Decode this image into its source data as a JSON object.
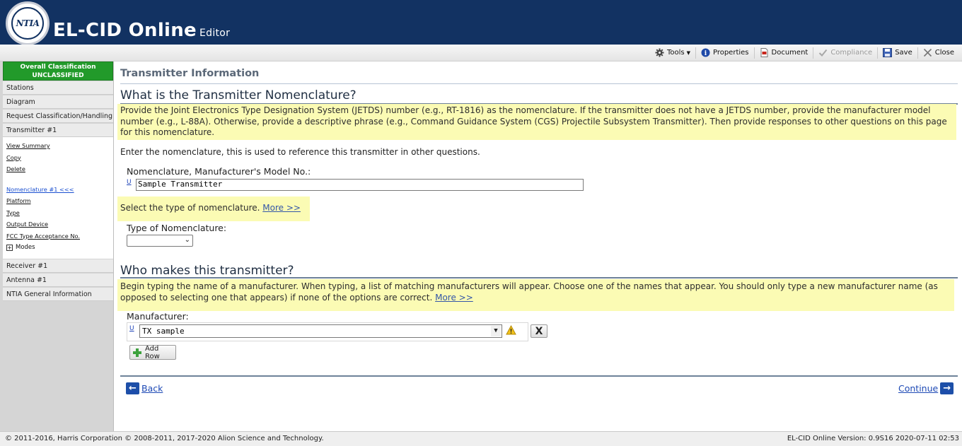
{
  "header": {
    "logo_text": "NTIA",
    "title": "EL-CID Online",
    "subtitle": "Editor"
  },
  "toolbar": {
    "tools": "Tools",
    "properties": "Properties",
    "document": "Document",
    "compliance": "Compliance",
    "save": "Save",
    "close": "Close"
  },
  "sidebar": {
    "classification_line1": "Overall Classification",
    "classification_line2": "UNCLASSIFIED",
    "stations": "Stations",
    "diagram": "Diagram",
    "request": "Request Classification/Handling",
    "transmitter": "Transmitter #1",
    "tx_links": [
      "View Summary",
      "Copy",
      "Delete"
    ],
    "tx_sections": [
      "Nomenclature #1 <<<",
      "Platform",
      "Type",
      "Output Device",
      "FCC Type Acceptance No."
    ],
    "modes": "Modes",
    "receiver": "Receiver #1",
    "antenna": "Antenna #1",
    "general": "NTIA General Information"
  },
  "main": {
    "page_title": "Transmitter Information",
    "q1_heading": "What is the Transmitter Nomenclature?",
    "q1_help": "Provide the Joint Electronics Type Designation System (JETDS) number (e.g., RT-1816) as the nomenclature. If the transmitter does not have a JETDS number, provide the manufacturer model number (e.g., L-88A). Otherwise, provide a descriptive phrase (e.g., Command Guidance System (CGS) Projectile Subsystem Transmitter). Then provide responses to other questions on this page for this nomenclature.",
    "q1_instruction": "Enter the nomenclature, this is used to reference this transmitter in other questions.",
    "nomen_label": "Nomenclature, Manufacturer's Model No.:",
    "u_mark": "U",
    "nomen_value": "Sample Transmitter",
    "type_help": "Select the type of nomenclature.",
    "more": "More >>",
    "type_label": "Type of Nomenclature:",
    "type_value": "",
    "q2_heading": "Who makes this transmitter?",
    "q2_help": "Begin typing the name of a manufacturer. When typing, a list of matching manufacturers will appear. Choose one of the names that appear. You should only type a new manufacturer name (as opposed to selecting one that appears) if none of the options are correct.",
    "manufacturer_label": "Manufacturer:",
    "manufacturer_value": "TX sample",
    "remove": "X",
    "add_row": "Add Row",
    "back": "Back",
    "continue": "Continue"
  },
  "footer": {
    "copyright": "© 2011-2016, Harris Corporation © 2008-2011, 2017-2020 Alion Science and Technology.",
    "version": "EL-CID Online Version: 0.9S16 2020-07-11 02:53"
  },
  "colors": {
    "header_bg": "#123262",
    "classification_bg": "#229a2a",
    "help_bg": "#fbfbb4",
    "link": "#1d49b5"
  },
  "icons": [
    "gear-icon",
    "info-icon",
    "pdf-icon",
    "check-icon",
    "save-icon",
    "close-icon",
    "warning-icon",
    "plus-icon",
    "back-arrow-icon",
    "continue-arrow-icon"
  ]
}
